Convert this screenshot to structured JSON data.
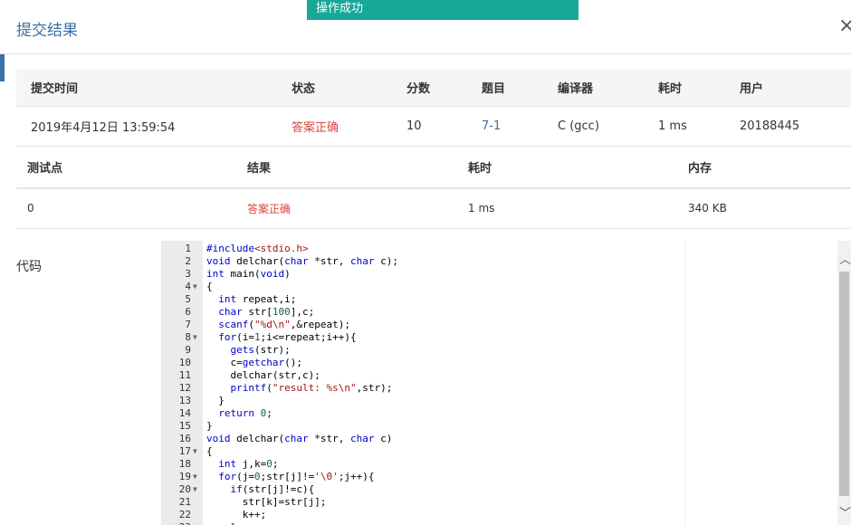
{
  "toast": {
    "text": "操作成功"
  },
  "dialog": {
    "title": "提交结果",
    "close": "×"
  },
  "submission": {
    "headers": [
      "提交时间",
      "状态",
      "分数",
      "题目",
      "编译器",
      "耗时",
      "用户"
    ],
    "row": [
      "2019年4月12日 13:59:54",
      "答案正确",
      "10",
      "7-1",
      "C (gcc)",
      "1 ms",
      "20188445"
    ]
  },
  "testpoints": {
    "headers": [
      "测试点",
      "结果",
      "耗时",
      "内存"
    ],
    "rows": [
      [
        "0",
        "答案正确",
        "1 ms",
        "340 KB"
      ]
    ]
  },
  "code": {
    "label": "代码",
    "lines": [
      "#include<stdio.h>",
      "void delchar(char *str, char c);",
      "int main(void)",
      "{",
      "  int repeat,i;",
      "  char str[100],c;",
      "  scanf(\"%d\\n\",&repeat);",
      "  for(i=1;i<=repeat;i++){",
      "    gets(str);",
      "    c=getchar();",
      "    delchar(str,c);",
      "    printf(\"result: %s\\n\",str);",
      "  }",
      "  return 0;",
      "}",
      "void delchar(char *str, char c)",
      "{",
      "  int j,k=0;",
      "  for(j=0;str[j]!='\\0';j++){",
      "    if(str[j]!=c){",
      "      str[k]=str[j];",
      "      k++;",
      "    }"
    ],
    "fold_lines": [
      4,
      8,
      17,
      19,
      20
    ]
  },
  "icons": {
    "scroll_up": "chevron-up-icon",
    "scroll_down": "chevron-down-icon"
  }
}
